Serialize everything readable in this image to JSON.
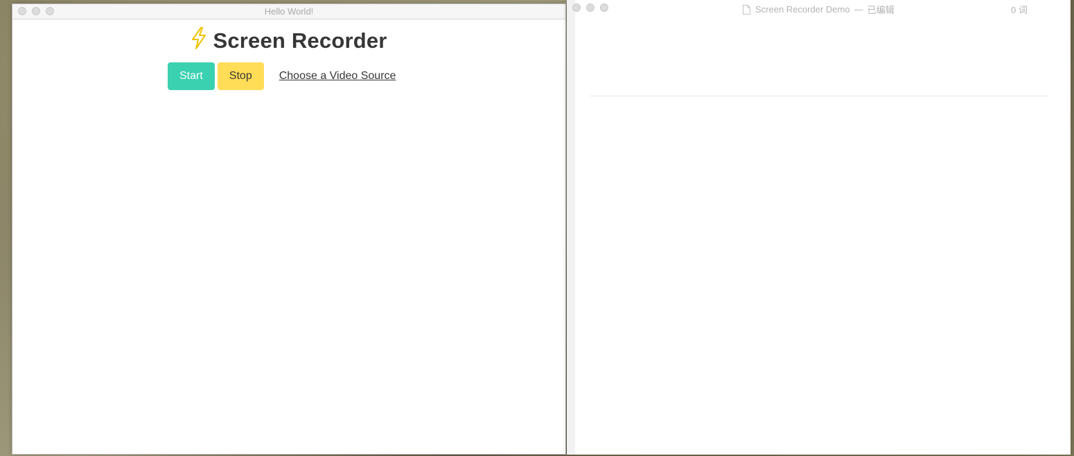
{
  "left_window": {
    "title": "Hello World!",
    "heading": "Screen Recorder",
    "heading_icon": "lightning-bolt-icon",
    "buttons": {
      "start_label": "Start",
      "stop_label": "Stop"
    },
    "source_link": "Choose a Video Source"
  },
  "right_window": {
    "title": "Screen Recorder Demo",
    "title_separator": "—",
    "title_status": "已编辑",
    "word_count": "0 词"
  },
  "colors": {
    "start_button": "#3ad1b1",
    "stop_button": "#ffdd57",
    "heading_text": "#363636",
    "bolt": "#f2c200"
  }
}
